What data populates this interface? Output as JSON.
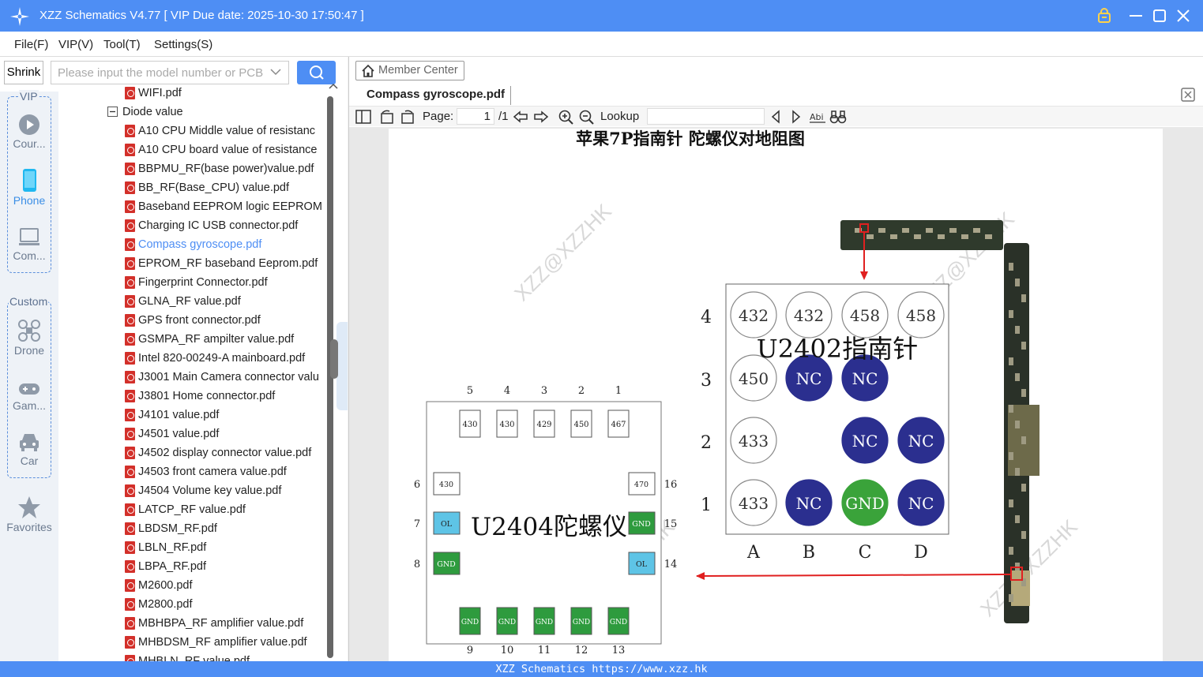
{
  "window": {
    "title": "XZZ Schematics V4.77 [ VIP Due date: 2025-10-30 17:50:47 ]"
  },
  "menu": [
    {
      "label": "File(F)"
    },
    {
      "label": "VIP(V)"
    },
    {
      "label": "Tool(T)"
    },
    {
      "label": "Settings(S)"
    }
  ],
  "search": {
    "shrink_label": "Shrink",
    "placeholder": "Please input the model number or PCB"
  },
  "sidebar": {
    "vip_caption": "VIP",
    "custom_caption": "Custom",
    "items": [
      {
        "label": "Cour...",
        "icon": "play-circle-icon"
      },
      {
        "label": "Phone",
        "icon": "phone-icon",
        "active": true
      },
      {
        "label": "Com...",
        "icon": "laptop-icon"
      },
      {
        "label": "Drone",
        "icon": "drone-icon"
      },
      {
        "label": "Gam...",
        "icon": "gamepad-icon"
      },
      {
        "label": "Car",
        "icon": "car-icon"
      },
      {
        "label": "Favorites",
        "icon": "star-icon"
      }
    ]
  },
  "tree": {
    "items": [
      {
        "label": "WIFI.pdf",
        "type": "file"
      },
      {
        "label": "Diode value",
        "type": "folder"
      },
      {
        "label": "A10 CPU Middle value of resistanc",
        "type": "file"
      },
      {
        "label": "A10 CPU board value of resistance",
        "type": "file"
      },
      {
        "label": "BBPMU_RF(base power)value.pdf",
        "type": "file"
      },
      {
        "label": "BB_RF(Base_CPU) value.pdf",
        "type": "file"
      },
      {
        "label": "Baseband EEPROM logic EEPROM.",
        "type": "file"
      },
      {
        "label": "Charging IC USB connector.pdf",
        "type": "file"
      },
      {
        "label": "Compass gyroscope.pdf",
        "type": "file",
        "selected": true
      },
      {
        "label": "EPROM_RF baseband Eeprom.pdf",
        "type": "file"
      },
      {
        "label": "Fingerprint Connector.pdf",
        "type": "file"
      },
      {
        "label": "GLNA_RF value.pdf",
        "type": "file"
      },
      {
        "label": "GPS front connector.pdf",
        "type": "file"
      },
      {
        "label": "GSMPA_RF ampilter value.pdf",
        "type": "file"
      },
      {
        "label": "Intel 820-00249-A mainboard.pdf",
        "type": "file"
      },
      {
        "label": "J3001 Main Camera connector valu",
        "type": "file"
      },
      {
        "label": "J3801 Home connector.pdf",
        "type": "file"
      },
      {
        "label": "J4101 value.pdf",
        "type": "file"
      },
      {
        "label": "J4501 value.pdf",
        "type": "file"
      },
      {
        "label": "J4502 display connector value.pdf",
        "type": "file"
      },
      {
        "label": "J4503 front camera value.pdf",
        "type": "file"
      },
      {
        "label": "J4504 Volume key value.pdf",
        "type": "file"
      },
      {
        "label": "LATCP_RF value.pdf",
        "type": "file"
      },
      {
        "label": "LBDSM_RF.pdf",
        "type": "file"
      },
      {
        "label": "LBLN_RF.pdf",
        "type": "file"
      },
      {
        "label": "LBPA_RF.pdf",
        "type": "file"
      },
      {
        "label": "M2600.pdf",
        "type": "file"
      },
      {
        "label": "M2800.pdf",
        "type": "file"
      },
      {
        "label": "MBHBPA_RF amplifier value.pdf",
        "type": "file"
      },
      {
        "label": "MHBDSM_RF amplifier value.pdf",
        "type": "file"
      },
      {
        "label": "MHBLN_RF value.pdf",
        "type": "file"
      }
    ]
  },
  "viewer": {
    "member_center": "Member Center",
    "tab_label": "Compass gyroscope.pdf",
    "page_label": "Page:",
    "page_current": "1",
    "page_total": "/1",
    "lookup_label": "Lookup"
  },
  "document": {
    "title": "苹果7P指南针  陀螺仪对地阻图",
    "watermark": "XZZ@XZZHK",
    "u2402": {
      "label": "U2402指南针",
      "rows": [
        "4",
        "3",
        "2",
        "1"
      ],
      "cols": [
        "A",
        "B",
        "C",
        "D"
      ],
      "cells": [
        [
          "432",
          "432",
          "458",
          "458"
        ],
        [
          "450",
          "NC",
          "NC",
          ""
        ],
        [
          "433",
          "",
          "NC",
          "NC"
        ],
        [
          "433",
          "NC",
          "GND",
          "NC"
        ]
      ]
    },
    "u2404": {
      "label": "U2404陀螺仪",
      "top_nums": [
        "5",
        "4",
        "3",
        "2",
        "1"
      ],
      "top_vals": [
        "430",
        "430",
        "429",
        "450",
        "467"
      ],
      "bottom_nums": [
        "9",
        "10",
        "11",
        "12",
        "13"
      ],
      "bottom_vals": [
        "GND",
        "GND",
        "GND",
        "GND",
        "GND"
      ],
      "left_nums": [
        "6",
        "7",
        "8"
      ],
      "left_vals": [
        "430",
        "OL",
        "GND"
      ],
      "right_nums": [
        "16",
        "15",
        "14"
      ],
      "right_vals": [
        "470",
        "GND",
        "OL"
      ]
    },
    "colors": {
      "nc": "#2b2f8f",
      "gnd": "#3aa33a",
      "ol": "#5ec4e6",
      "pad_gnd": "#2e9b3e",
      "arrow": "#e02020"
    }
  },
  "status": {
    "text": "XZZ Schematics https://www.xzz.hk"
  }
}
